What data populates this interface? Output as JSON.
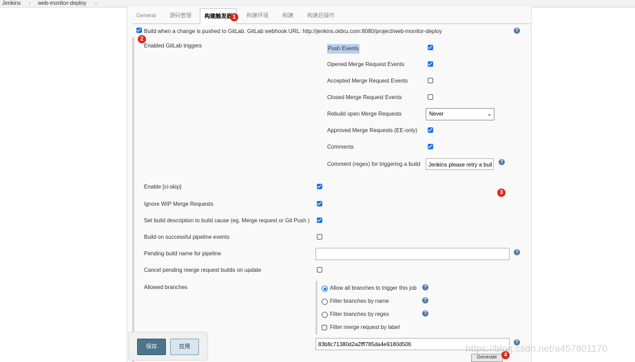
{
  "breadcrumb": [
    "Jenkins",
    "web-monitor-deploy"
  ],
  "tabs": [
    "General",
    "源码管理",
    "构建触发器",
    "构建环境",
    "构建",
    "构建后操作"
  ],
  "badges": [
    "1",
    "2",
    "3",
    "4"
  ],
  "gitlab": {
    "build_when_pushed": "Build when a change is pushed to GitLab. GitLab webhook URL: http://jenkins.oldxu.com:8080/project/web-monitor-deploy",
    "enabled_triggers": "Enabled GitLab triggers",
    "push_events": "Push Events",
    "opened_mr": "Opened Merge Request Events",
    "accepted_mr": "Accepted Merge Request Events",
    "closed_mr": "Closed Merge Request Events",
    "rebuild_open_mr": "Rebuild open Merge Requests",
    "rebuild_value": "Never",
    "approved_mr": "Approved Merge Requests (EE-only)",
    "comments": "Comments",
    "comment_regex": "Comment (regex) for triggering a build",
    "comment_regex_value": "Jenkins please retry a buil"
  },
  "advanced": {
    "ci_skip": "Enable [ci-skip]",
    "ignore_wip": "Ignore WIP Merge Requests",
    "set_description": "Set build description to build cause (eg. Merge request or Git Push )",
    "build_on_pipeline": "Build on successful pipeline events",
    "pending_name": "Pending build name for pipeline",
    "cancel_pending": "Cancel pending merge request builds on update",
    "allowed_branches": "Allowed branches",
    "allow_all": "Allow all branches to trigger this job",
    "filter_by_name": "Filter branches by name",
    "filter_by_regex": "Filter branches by regex",
    "filter_by_label": "Filter merge request by label",
    "secret_token": "83b8c71380d2a2fff785da4e9180d506",
    "generate": "Generate"
  },
  "buttons": {
    "save": "保存",
    "apply": "应用"
  },
  "watermark": "https://blog.csdn.net/a457801170",
  "help_glyph": "?",
  "select_caret": "⌄",
  "colors": {
    "accent": "#1a73e8",
    "badge": "#d9291c",
    "save_button": "#4b758b",
    "help": "#4f78a7"
  }
}
